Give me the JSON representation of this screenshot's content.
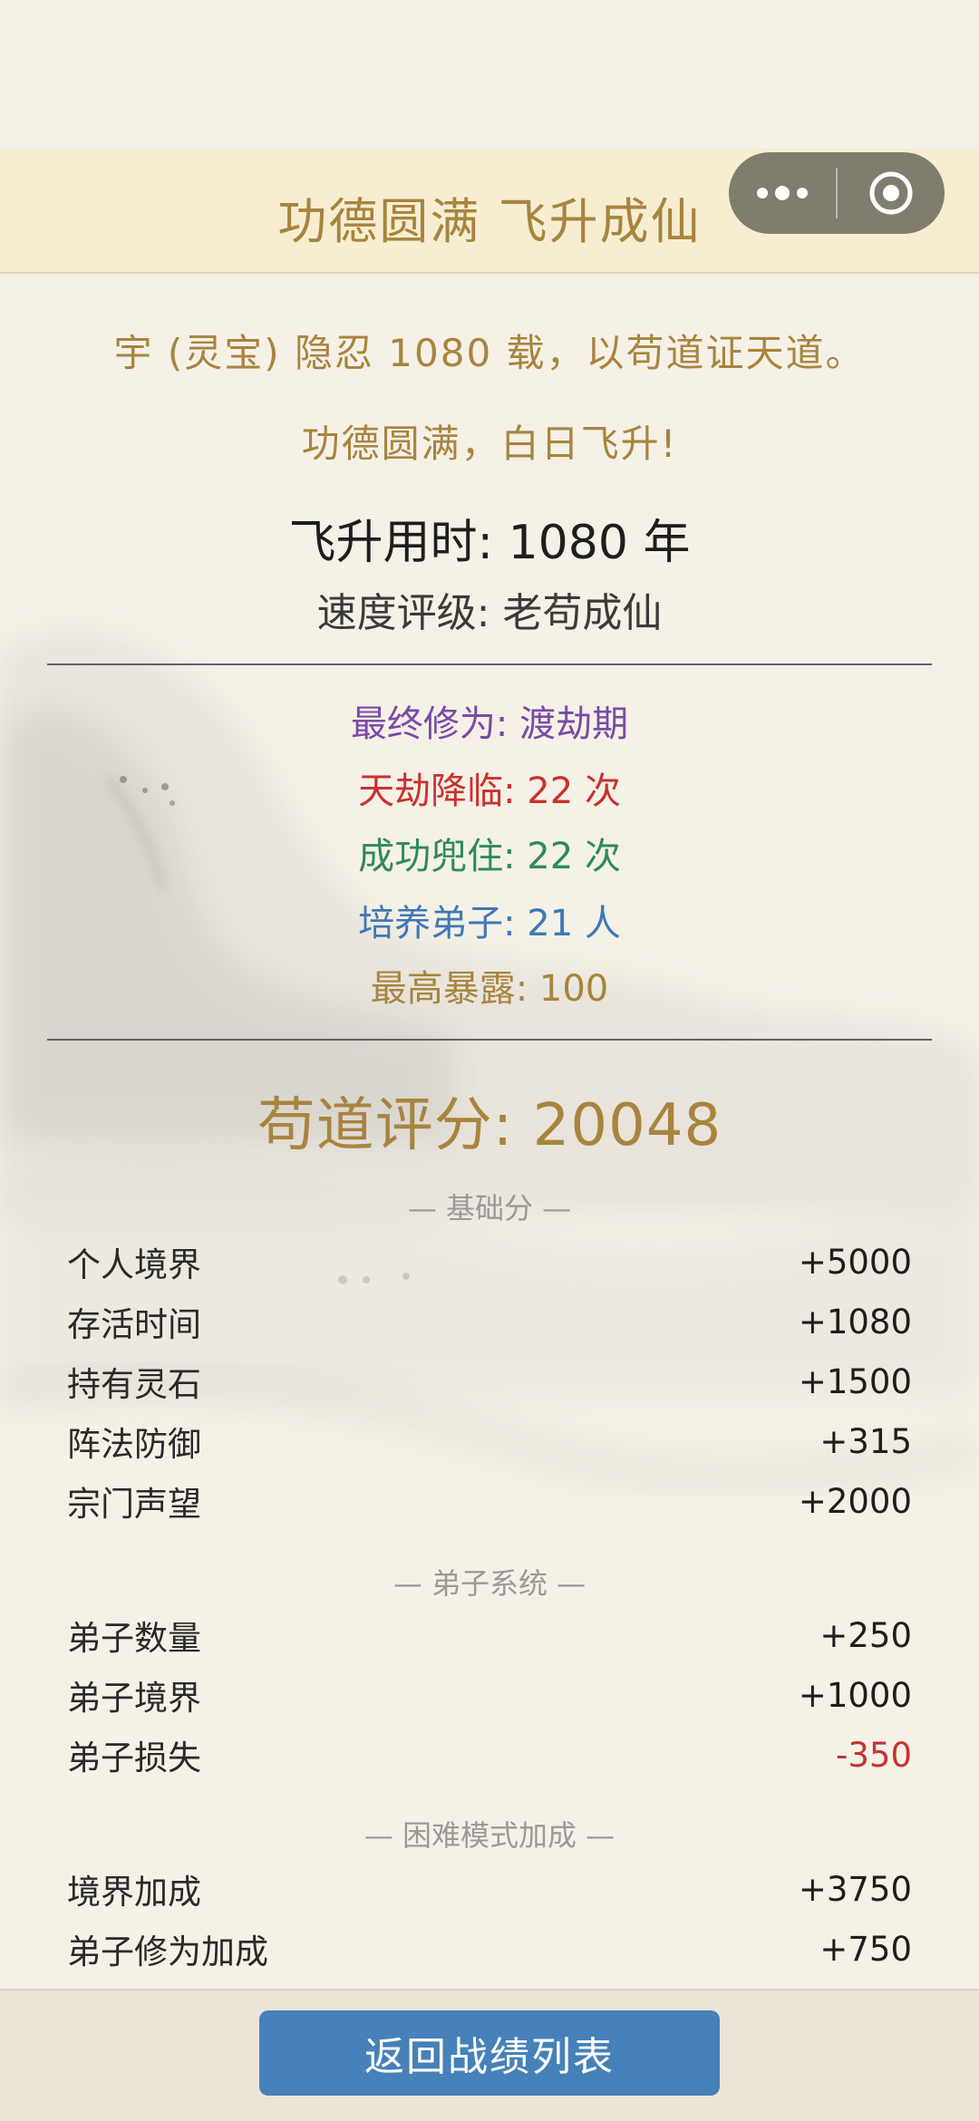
{
  "header": {
    "title": "功德圆满 飞升成仙",
    "capsule": {
      "more_icon": "more-dots-icon",
      "close_icon": "target-icon"
    }
  },
  "story": {
    "line1": "宇 (灵宝) 隐忍 1080 载，以苟道证天道。",
    "line2": "功德圆满，白日飞升!"
  },
  "summary": {
    "ascend_time": "飞升用时: 1080 年",
    "speed_grade": "速度评级: 老苟成仙"
  },
  "stats": {
    "realm": "最终修为: 渡劫期",
    "tribulations": "天劫降临: 22 次",
    "survived": "成功兜住: 22 次",
    "disciples": "培养弟子: 21 人",
    "max_exposure": "最高暴露: 100"
  },
  "score": {
    "total": "苟道评分: 20048"
  },
  "sections": {
    "base": {
      "title": "— 基础分 —",
      "rows": [
        {
          "label": "个人境界",
          "value": "+5000"
        },
        {
          "label": "存活时间",
          "value": "+1080"
        },
        {
          "label": "持有灵石",
          "value": "+1500"
        },
        {
          "label": "阵法防御",
          "value": "+315"
        },
        {
          "label": "宗门声望",
          "value": "+2000"
        }
      ]
    },
    "disciple": {
      "title": "— 弟子系统 —",
      "rows": [
        {
          "label": "弟子数量",
          "value": "+250"
        },
        {
          "label": "弟子境界",
          "value": "+1000"
        },
        {
          "label": "弟子损失",
          "value": "-350"
        }
      ]
    },
    "hard": {
      "title": "— 困难模式加成 —",
      "rows": [
        {
          "label": "境界加成",
          "value": "+3750"
        },
        {
          "label": "弟子修为加成",
          "value": "+750"
        }
      ]
    }
  },
  "footer": {
    "return_label": "返回战绩列表"
  },
  "colors": {
    "gold": "#a8843e",
    "purple": "#7a4aa8",
    "red": "#c8322e",
    "green": "#2e8a5a",
    "blue": "#3f78b5",
    "button": "#4681b9"
  }
}
